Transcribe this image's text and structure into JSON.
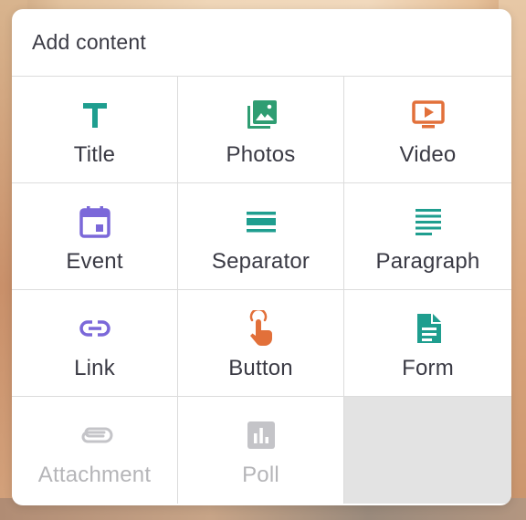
{
  "panel": {
    "title": "Add content"
  },
  "colors": {
    "teal": "#1f9e8f",
    "green": "#2f9d72",
    "orange": "#e2703a",
    "purple": "#7b68d9",
    "disabled": "#c4c4c8",
    "text": "#3a3a44",
    "empty_cell": "#e3e3e3"
  },
  "items": [
    {
      "label": "Title",
      "icon": "text-title-icon",
      "enabled": true
    },
    {
      "label": "Photos",
      "icon": "photo-library-icon",
      "enabled": true
    },
    {
      "label": "Video",
      "icon": "video-play-icon",
      "enabled": true
    },
    {
      "label": "Event",
      "icon": "calendar-icon",
      "enabled": true
    },
    {
      "label": "Separator",
      "icon": "separator-icon",
      "enabled": true
    },
    {
      "label": "Paragraph",
      "icon": "paragraph-lines-icon",
      "enabled": true
    },
    {
      "label": "Link",
      "icon": "link-icon",
      "enabled": true
    },
    {
      "label": "Button",
      "icon": "tap-hand-icon",
      "enabled": true
    },
    {
      "label": "Form",
      "icon": "form-document-icon",
      "enabled": true
    },
    {
      "label": "Attachment",
      "icon": "paperclip-icon",
      "enabled": false
    },
    {
      "label": "Poll",
      "icon": "poll-chart-icon",
      "enabled": false
    }
  ]
}
